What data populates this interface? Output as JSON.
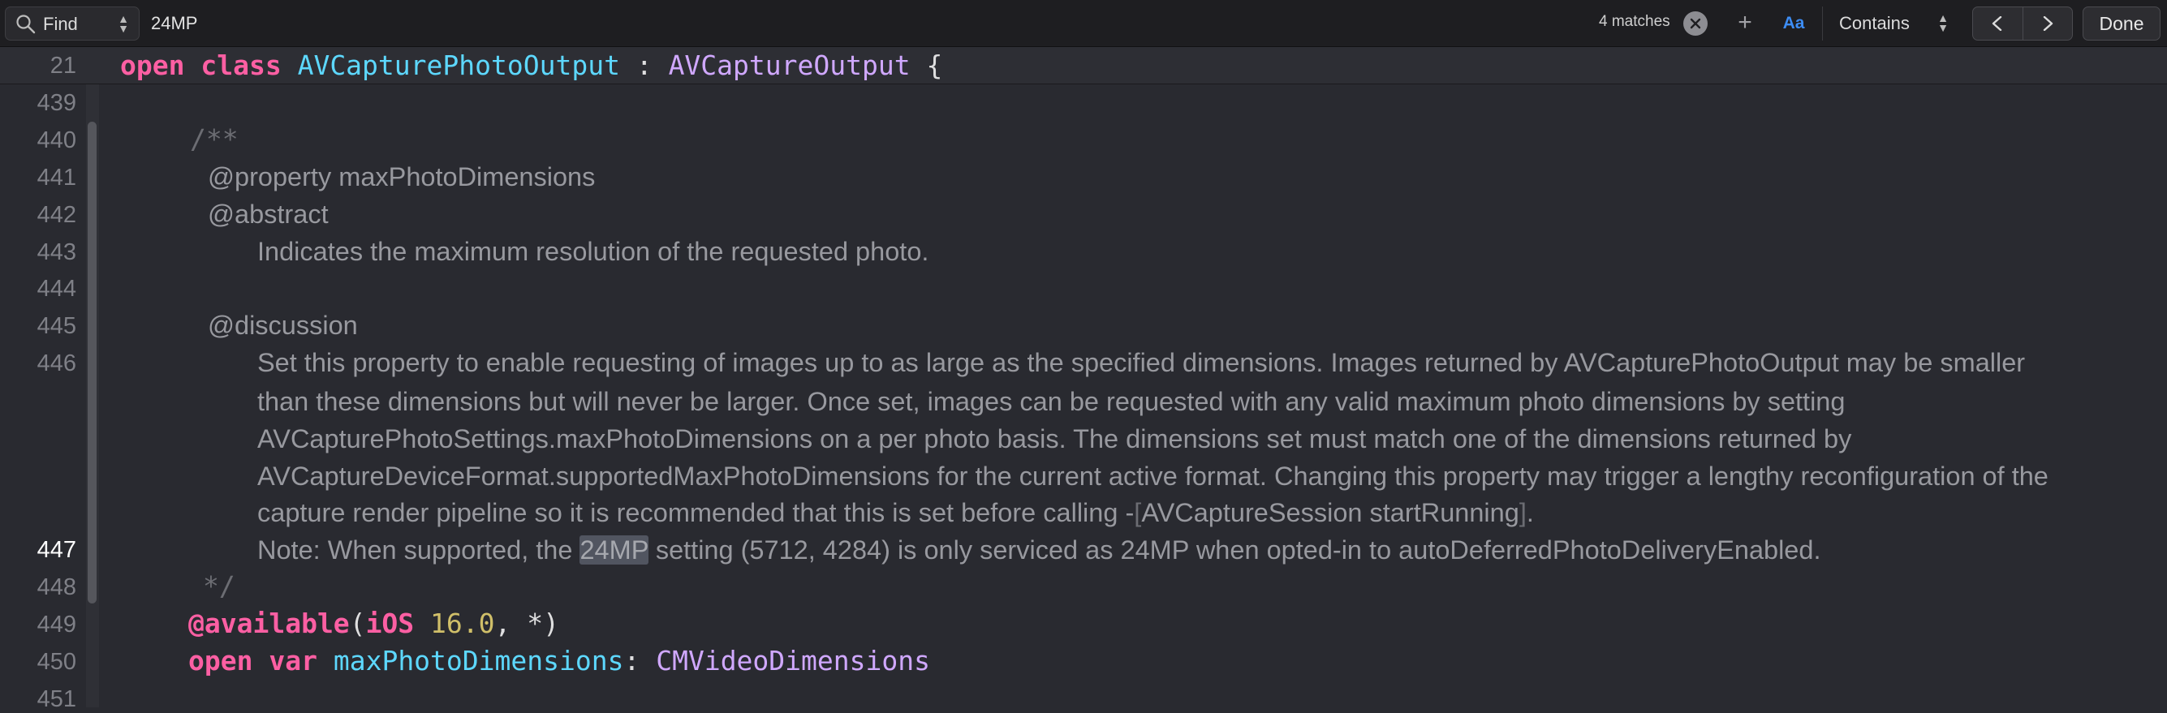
{
  "find_bar": {
    "mode": "Find",
    "query": "24MP",
    "match_count": "4 matches",
    "add_label": "+",
    "case_label": "Aa",
    "match_type": "Contains",
    "done_label": "Done"
  },
  "sticky_header": {
    "line_number": "21",
    "tokens": [
      "open",
      "class",
      "AVCapturePhotoOutput",
      ":",
      "AVCaptureOutput",
      "{"
    ]
  },
  "gutter": {
    "line_numbers": [
      "439",
      "440",
      "441",
      "442",
      "443",
      "444",
      "445",
      "446",
      "447",
      "448",
      "449",
      "450",
      "451"
    ],
    "current_line": "447"
  },
  "doc_comment": {
    "open": "/**",
    "property_line": "@property maxPhotoDimensions",
    "abstract_tag": "@abstract",
    "abstract_text": "Indicates the maximum resolution of the requested photo.",
    "discussion_tag": "@discussion",
    "discussion_lines": [
      "Set this property to enable requesting of images up to as large as the specified dimensions. Images returned by AVCapturePhotoOutput may be smaller",
      "than these dimensions but will never be larger. Once set, images can be requested with any valid maximum photo dimensions by setting",
      "AVCapturePhotoSettings.maxPhotoDimensions on a per photo basis. The dimensions set must match one of the dimensions returned by",
      "AVCaptureDeviceFormat.supportedMaxPhotoDimensions for the current active format. Changing this property may trigger a lengthy reconfiguration of the"
    ],
    "render_line_prefix": "capture render pipeline so it is recommended that this is set before calling -",
    "render_line_bracket_open": "[",
    "render_line_code": "AVCaptureSession startRunning",
    "render_line_bracket_close": "]",
    "render_line_end": ".",
    "note_prefix": "Note: When supported, the ",
    "note_match": "24MP",
    "note_suffix": " setting (5712, 4284) is only serviced as 24MP when opted-in to autoDeferredPhotoDeliveryEnabled.",
    "close": "*/"
  },
  "code_lines": {
    "available_attr": "@available",
    "available_paren_open": "(",
    "available_platform": "iOS",
    "available_version": "16.0",
    "available_rest": ", *)",
    "decl_open": "open",
    "decl_var": "var",
    "decl_name": "maxPhotoDimensions",
    "decl_colon": ": ",
    "decl_type": "CMVideoDimensions"
  },
  "colors": {
    "editor_background": "#292a30",
    "keyword": "#fc5fa3",
    "type_project": "#5dd8ff",
    "type_system": "#d0a8ff",
    "number": "#d0bf69",
    "comment": "#98999f",
    "accent": "#3d8df5"
  }
}
